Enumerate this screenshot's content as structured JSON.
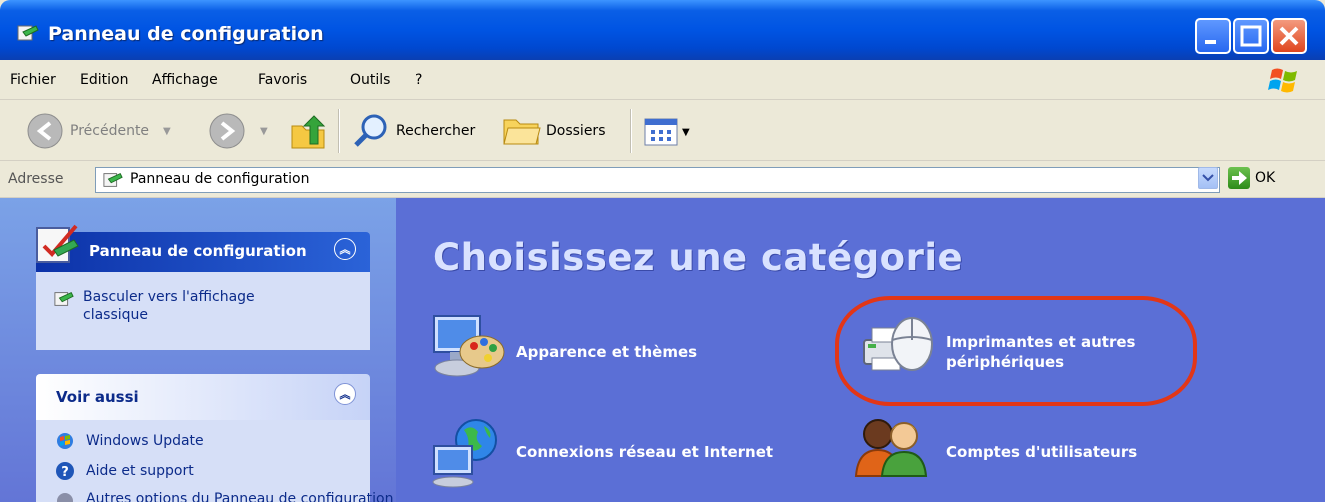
{
  "window": {
    "title": "Panneau de configuration"
  },
  "menu": {
    "items": [
      "Fichier",
      "Edition",
      "Affichage",
      "Favoris",
      "Outils",
      "?"
    ]
  },
  "toolbar": {
    "back_label": "Précédente",
    "search_label": "Rechercher",
    "folders_label": "Dossiers"
  },
  "address": {
    "label": "Adresse",
    "value": "Panneau de configuration",
    "go_label": "OK"
  },
  "sidebar": {
    "panel_title": "Panneau de configuration",
    "switch_link": "Basculer vers l'affichage classique",
    "see_also_title": "Voir aussi",
    "see_also_items": [
      "Windows Update",
      "Aide et support",
      "Autres options du Panneau de configuration"
    ]
  },
  "main": {
    "heading": "Choisissez une catégorie",
    "categories": [
      {
        "label": "Apparence et thèmes",
        "icon": "appearance-themes-icon"
      },
      {
        "label": "Imprimantes et autres périphériques",
        "icon": "printer-mouse-icon"
      },
      {
        "label": "Connexions réseau et Internet",
        "icon": "network-globe-icon"
      },
      {
        "label": "Comptes d'utilisateurs",
        "icon": "user-accounts-icon"
      }
    ]
  },
  "colors": {
    "title_bar": "#0054e3",
    "main_bg": "#5b6fd6",
    "highlight": "#e23617"
  }
}
